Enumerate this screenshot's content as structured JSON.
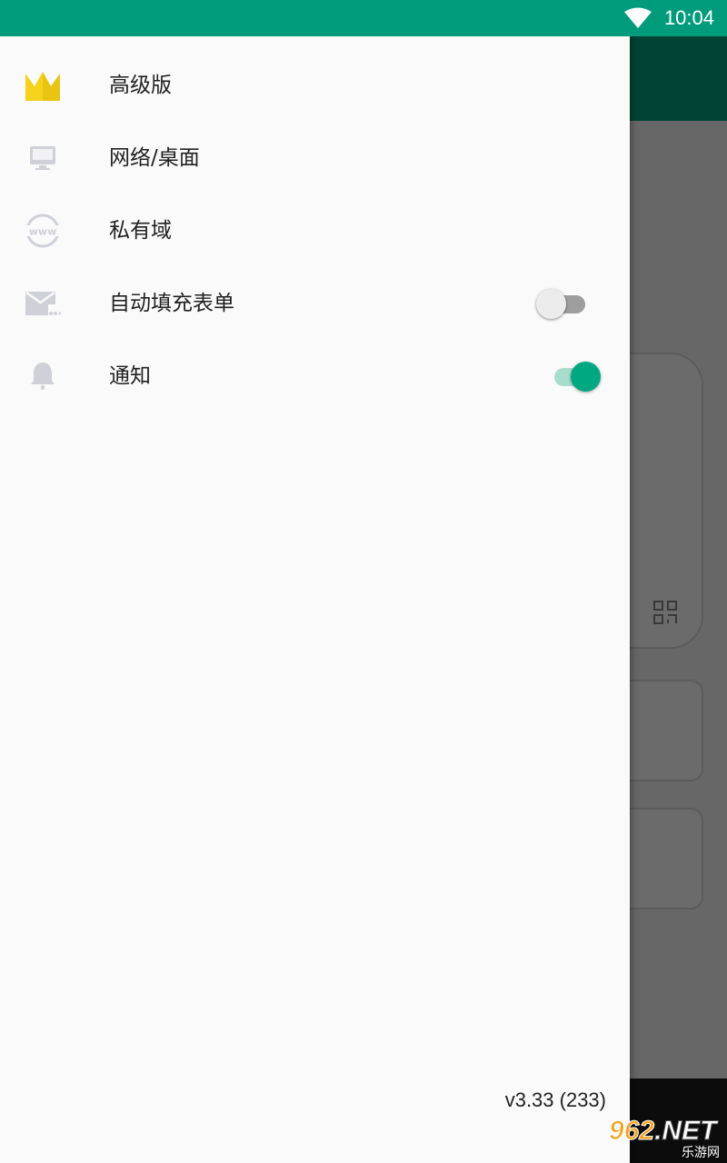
{
  "status_bar": {
    "time": "10:04",
    "wifi_icon": "wifi-icon"
  },
  "drawer": {
    "items": [
      {
        "label": "高级版",
        "icon": "crown-icon"
      },
      {
        "label": "网络/桌面",
        "icon": "monitor-icon"
      },
      {
        "label": "私有域",
        "icon": "www-globe-icon"
      },
      {
        "label": "自动填充表单",
        "icon": "mail-icon",
        "toggle": false
      },
      {
        "label": "通知",
        "icon": "bell-icon",
        "toggle": true
      }
    ],
    "version": "v3.33 (233)"
  },
  "watermark": {
    "brand": "962",
    "suffix": ".NET",
    "subtitle": "乐游网"
  },
  "colors": {
    "status_bar": "#009b7a",
    "accent": "#00a881",
    "crown": "#f5d21b"
  }
}
